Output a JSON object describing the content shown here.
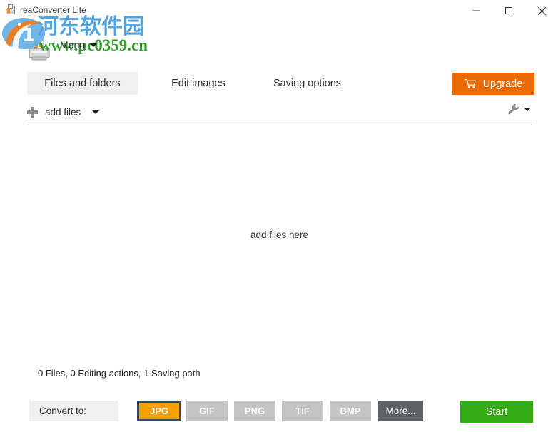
{
  "window": {
    "title": "reaConverter Lite",
    "icon": "app-printer-icon",
    "controls": {
      "minimize": "minimize-icon",
      "maximize": "maximize-icon",
      "close": "close-icon"
    }
  },
  "watermark": {
    "chinese_text": "河东软件园",
    "url_text": "www.pc0359.cn",
    "chinese_color": "#51a3dd",
    "url_color": "#2f9e28",
    "logo_blue": "#4da3dd",
    "logo_orange": "#f07c1e"
  },
  "menu": {
    "label": "Menu",
    "caret": "chevron-down-icon",
    "printer_icon": "printer-icon"
  },
  "tabs": [
    {
      "label": "Files and folders",
      "active": true
    },
    {
      "label": "Edit images",
      "active": false
    },
    {
      "label": "Saving options",
      "active": false
    }
  ],
  "upgrade": {
    "label": "Upgrade",
    "icon": "shopping-cart-icon",
    "color": "#ea6a03"
  },
  "toolbar": {
    "add_files_label": "add files",
    "add_files_icon": "plus-icon",
    "add_files_caret": "chevron-down-icon",
    "settings_icon": "wrench-icon",
    "settings_caret": "chevron-down-icon"
  },
  "drop_area": {
    "hint": "add files here"
  },
  "status": {
    "text": "0 Files, 0 Editing actions, 1 Saving path"
  },
  "bottom": {
    "convert_label": "Convert to:",
    "formats": [
      {
        "label": "JPG",
        "selected": true
      },
      {
        "label": "GIF",
        "selected": false
      },
      {
        "label": "PNG",
        "selected": false
      },
      {
        "label": "TIF",
        "selected": false
      },
      {
        "label": "BMP",
        "selected": false
      }
    ],
    "more_label": "More...",
    "start_label": "Start",
    "selected_color": "#f5a200",
    "start_color": "#33aa11"
  }
}
